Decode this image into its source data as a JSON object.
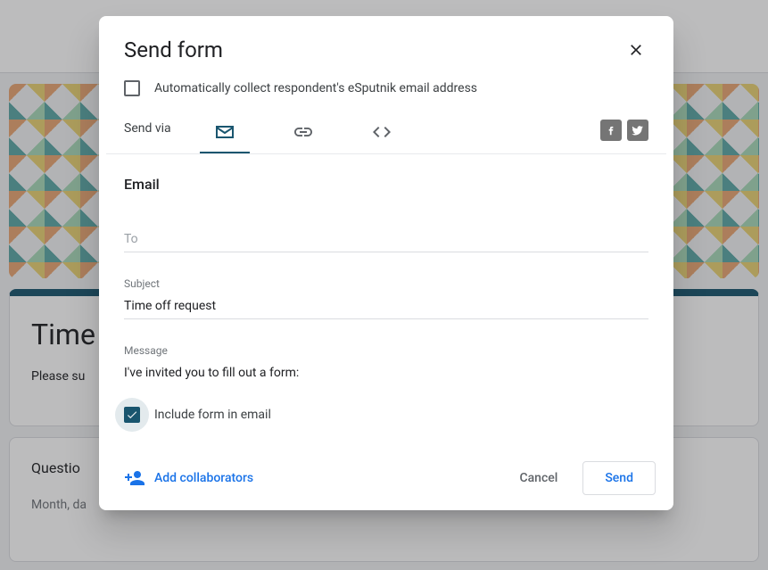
{
  "background": {
    "title": "Time",
    "subtitle": "Please su",
    "question": "Questio",
    "hint": "Month, da"
  },
  "modal": {
    "title": "Send form",
    "collect_label": "Automatically collect respondent's eSputnik email address",
    "send_via_label": "Send via",
    "email_heading": "Email",
    "to": {
      "placeholder": "To",
      "value": ""
    },
    "subject": {
      "label": "Subject",
      "value": "Time off request"
    },
    "message": {
      "label": "Message",
      "value": "I've invited you to fill out a form:"
    },
    "include_label": "Include form in email",
    "include_checked": true,
    "add_collaborators": "Add collaborators",
    "cancel": "Cancel",
    "send": "Send"
  }
}
